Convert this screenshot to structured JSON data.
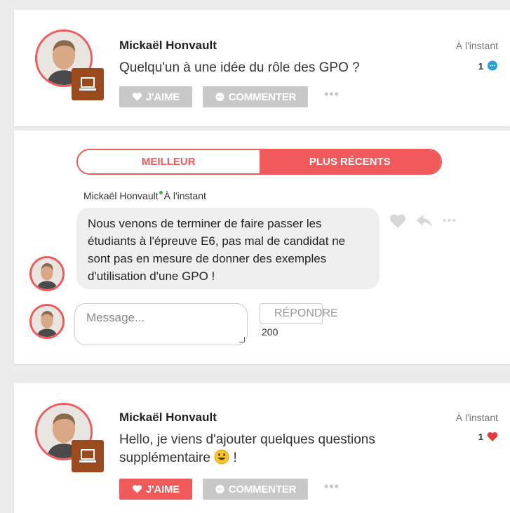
{
  "posts": [
    {
      "author": "Mickaël Honvault",
      "text": "Quelqu'un à une idée du rôle des GPO ?",
      "timestamp": "À l'instant",
      "count": "1",
      "count_icon": "comment-bubble-icon",
      "count_color": "#2aa0d8",
      "like_label": "J'AIME",
      "comment_label": "COMMENTER",
      "liked": false
    },
    {
      "author": "Mickaël Honvault",
      "text": "Hello, je viens d'ajouter quelques questions supplémentaire",
      "text_suffix": "!",
      "emoji": "smiley-emoji",
      "timestamp": "À l'instant",
      "count": "1",
      "count_icon": "heart-icon",
      "count_color": "#e8383d",
      "like_label": "J'AIME",
      "comment_label": "COMMENTER",
      "liked": true
    }
  ],
  "thread": {
    "tabs": [
      {
        "label": "MEILLEUR",
        "active": false
      },
      {
        "label": "PLUS RÉCENTS",
        "active": true
      }
    ],
    "comment": {
      "author": "Mickaël Honvault",
      "timestamp": "À l'instant",
      "text": "Nous venons de terminer de faire passer les étudiants à l'épreuve E6, pas mal de candidat ne sont pas en mesure de donner des exemples d'utilisation d'une GPO !"
    },
    "reply": {
      "placeholder": "Message...",
      "button_label": "RÉPONDRE",
      "char_count": "200"
    }
  },
  "colors": {
    "accent": "#f05a5a",
    "button_gray": "#c8c8c8",
    "device_badge": "#9b4a1e"
  }
}
